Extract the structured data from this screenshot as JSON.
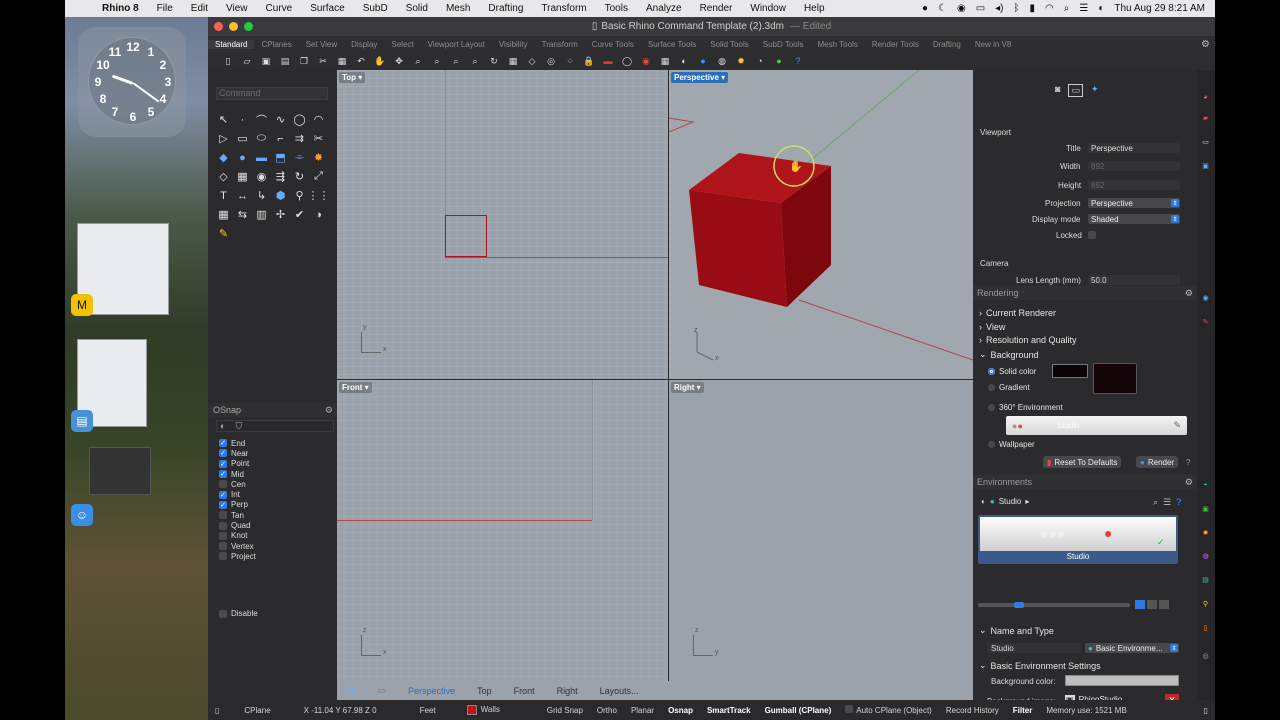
{
  "menubar": {
    "app_name": "Rhino 8",
    "items": [
      "File",
      "Edit",
      "View",
      "Curve",
      "Surface",
      "SubD",
      "Solid",
      "Mesh",
      "Drafting",
      "Transform",
      "Tools",
      "Analyze",
      "Render",
      "Window",
      "Help"
    ],
    "datetime": "Thu Aug 29  8:21 AM"
  },
  "clock": {
    "numbers": [
      "12",
      "1",
      "2",
      "3",
      "4",
      "5",
      "6",
      "7",
      "8",
      "9",
      "10",
      "11"
    ]
  },
  "window": {
    "title": "Basic Rhino Command Template (2).3dm",
    "title_suffix": "— Edited"
  },
  "tabs": [
    "Standard",
    "CPlanes",
    "Set View",
    "Display",
    "Select",
    "Viewport Layout",
    "Visibility",
    "Transform",
    "Curve Tools",
    "Surface Tools",
    "Solid Tools",
    "SubD Tools",
    "Mesh Tools",
    "Render Tools",
    "Drafting",
    "New in V8"
  ],
  "command": {
    "placeholder": "Command"
  },
  "osnap": {
    "title": "OSnap",
    "items": [
      {
        "label": "End",
        "checked": true
      },
      {
        "label": "Near",
        "checked": true
      },
      {
        "label": "Point",
        "checked": true
      },
      {
        "label": "Mid",
        "checked": true
      },
      {
        "label": "Cen",
        "checked": false
      },
      {
        "label": "Int",
        "checked": true
      },
      {
        "label": "Perp",
        "checked": true
      },
      {
        "label": "Tan",
        "checked": false
      },
      {
        "label": "Quad",
        "checked": false
      },
      {
        "label": "Knot",
        "checked": false
      },
      {
        "label": "Vertex",
        "checked": false
      },
      {
        "label": "Project",
        "checked": false
      }
    ],
    "disable_label": "Disable"
  },
  "viewports": {
    "top": "Top",
    "perspective": "Perspective",
    "front": "Front",
    "right": "Right"
  },
  "viewport_tabs": [
    "Perspective",
    "Top",
    "Front",
    "Right",
    "Layouts..."
  ],
  "properties": {
    "section": "Viewport",
    "title_label": "Title",
    "title_value": "Perspective",
    "width_label": "Width",
    "width_value": "892",
    "height_label": "Height",
    "height_value": "892",
    "projection_label": "Projection",
    "projection_value": "Perspective",
    "display_mode_label": "Display mode",
    "display_mode_value": "Shaded",
    "locked_label": "Locked",
    "camera_label": "Camera",
    "lens_label": "Lens Length (mm)",
    "lens_value": "50.0"
  },
  "rendering": {
    "title": "Rendering",
    "rows": [
      "Current Renderer",
      "View",
      "Resolution and Quality",
      "Background"
    ],
    "solid_color": "Solid color",
    "gradient": "Gradient",
    "env360": "360° Environment",
    "env_name": "Studio",
    "wallpaper": "Wallpaper",
    "reset_btn": "Reset To Defaults",
    "render_btn": "Render"
  },
  "environments": {
    "title": "Environments",
    "current": "Studio",
    "thumb_label": "Studio",
    "name_type_label": "Name and Type",
    "name_value": "Studio",
    "type_value": "Basic Environme...",
    "settings_label": "Basic Environment Settings",
    "bg_color_label": "Background color:",
    "bg_image_label": "Background image:",
    "bg_image_value": "RhinoStudio"
  },
  "status": {
    "cplane": "CPlane",
    "coords": "X -11.04 Y 67.98 Z 0",
    "units": "Feet",
    "layer": "Walls",
    "grid_snap": "Grid Snap",
    "ortho": "Ortho",
    "planar": "Planar",
    "osnap": "Osnap",
    "smarttrack": "SmartTrack",
    "gumball": "Gumball (CPlane)",
    "auto_cplane": "Auto CPlane (Object)",
    "record_history": "Record History",
    "filter": "Filter",
    "memory": "Memory use: 1521 MB"
  },
  "colors": {
    "accent": "#2f7ae5",
    "cube": "#a00c14",
    "viewport_bg": "#9aa2ab"
  }
}
